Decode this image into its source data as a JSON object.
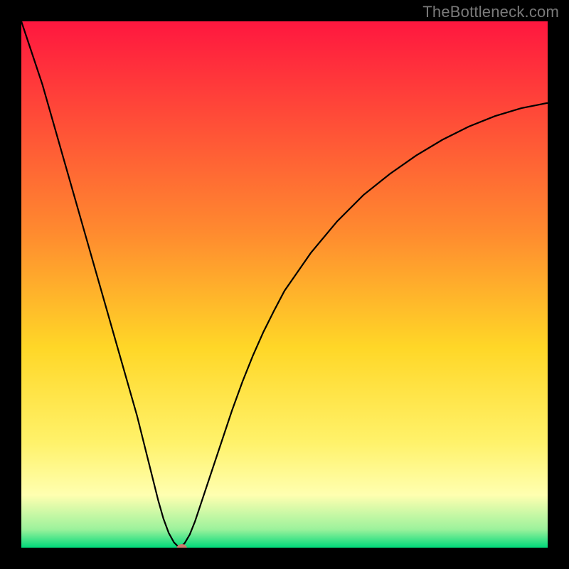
{
  "watermark": "TheBottleneck.com",
  "chart_data": {
    "type": "line",
    "title": "",
    "xlabel": "",
    "ylabel": "",
    "xlim": [
      0,
      100
    ],
    "ylim": [
      0,
      100
    ],
    "optimum_x": 30,
    "gradient_stops": [
      {
        "t": 0.0,
        "color": "#ff173f"
      },
      {
        "t": 0.4,
        "color": "#ff8a2f"
      },
      {
        "t": 0.62,
        "color": "#ffd727"
      },
      {
        "t": 0.8,
        "color": "#fff26a"
      },
      {
        "t": 0.9,
        "color": "#ffffb0"
      },
      {
        "t": 0.965,
        "color": "#9cf29c"
      },
      {
        "t": 1.0,
        "color": "#00d97a"
      }
    ],
    "curve": {
      "x": [
        0,
        2,
        4,
        6,
        8,
        10,
        12,
        14,
        16,
        18,
        20,
        22,
        24,
        26,
        27,
        28,
        29,
        30,
        31,
        32,
        33,
        34,
        36,
        38,
        40,
        42,
        44,
        46,
        48,
        50,
        55,
        60,
        65,
        70,
        75,
        80,
        85,
        90,
        95,
        100
      ],
      "y": [
        100,
        94,
        88,
        81,
        74,
        67,
        60,
        53,
        46,
        39,
        32,
        25,
        17,
        9,
        5.5,
        2.8,
        1.0,
        0,
        0.8,
        2.5,
        5.0,
        8.0,
        14,
        20,
        26,
        31.5,
        36.5,
        41,
        45,
        48.8,
        56,
        62,
        67,
        71,
        74.5,
        77.5,
        80,
        82,
        83.5,
        84.5
      ]
    },
    "marker": {
      "x": 30.5,
      "y": 0,
      "color": "#cc7a6e",
      "rx": 7,
      "ry": 5
    }
  }
}
